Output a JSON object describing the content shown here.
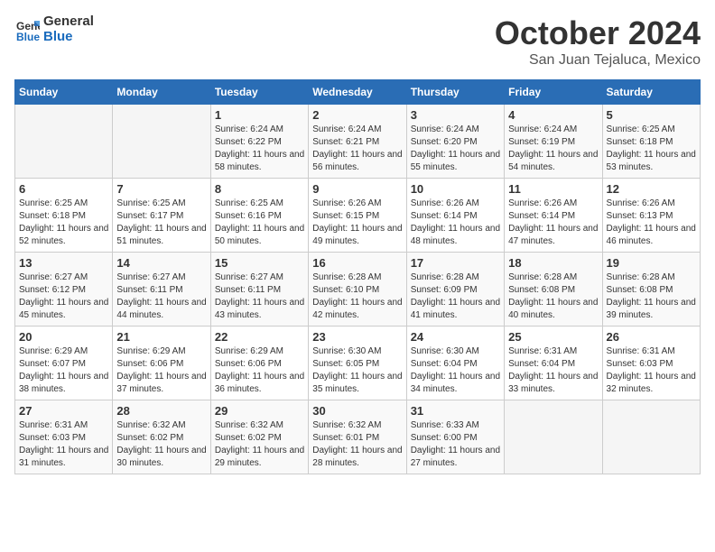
{
  "header": {
    "logo_line1": "General",
    "logo_line2": "Blue",
    "month_year": "October 2024",
    "location": "San Juan Tejaluca, Mexico"
  },
  "weekdays": [
    "Sunday",
    "Monday",
    "Tuesday",
    "Wednesday",
    "Thursday",
    "Friday",
    "Saturday"
  ],
  "weeks": [
    [
      {
        "day": "",
        "sunrise": "",
        "sunset": "",
        "daylight": ""
      },
      {
        "day": "",
        "sunrise": "",
        "sunset": "",
        "daylight": ""
      },
      {
        "day": "1",
        "sunrise": "Sunrise: 6:24 AM",
        "sunset": "Sunset: 6:22 PM",
        "daylight": "Daylight: 11 hours and 58 minutes."
      },
      {
        "day": "2",
        "sunrise": "Sunrise: 6:24 AM",
        "sunset": "Sunset: 6:21 PM",
        "daylight": "Daylight: 11 hours and 56 minutes."
      },
      {
        "day": "3",
        "sunrise": "Sunrise: 6:24 AM",
        "sunset": "Sunset: 6:20 PM",
        "daylight": "Daylight: 11 hours and 55 minutes."
      },
      {
        "day": "4",
        "sunrise": "Sunrise: 6:24 AM",
        "sunset": "Sunset: 6:19 PM",
        "daylight": "Daylight: 11 hours and 54 minutes."
      },
      {
        "day": "5",
        "sunrise": "Sunrise: 6:25 AM",
        "sunset": "Sunset: 6:18 PM",
        "daylight": "Daylight: 11 hours and 53 minutes."
      }
    ],
    [
      {
        "day": "6",
        "sunrise": "Sunrise: 6:25 AM",
        "sunset": "Sunset: 6:18 PM",
        "daylight": "Daylight: 11 hours and 52 minutes."
      },
      {
        "day": "7",
        "sunrise": "Sunrise: 6:25 AM",
        "sunset": "Sunset: 6:17 PM",
        "daylight": "Daylight: 11 hours and 51 minutes."
      },
      {
        "day": "8",
        "sunrise": "Sunrise: 6:25 AM",
        "sunset": "Sunset: 6:16 PM",
        "daylight": "Daylight: 11 hours and 50 minutes."
      },
      {
        "day": "9",
        "sunrise": "Sunrise: 6:26 AM",
        "sunset": "Sunset: 6:15 PM",
        "daylight": "Daylight: 11 hours and 49 minutes."
      },
      {
        "day": "10",
        "sunrise": "Sunrise: 6:26 AM",
        "sunset": "Sunset: 6:14 PM",
        "daylight": "Daylight: 11 hours and 48 minutes."
      },
      {
        "day": "11",
        "sunrise": "Sunrise: 6:26 AM",
        "sunset": "Sunset: 6:14 PM",
        "daylight": "Daylight: 11 hours and 47 minutes."
      },
      {
        "day": "12",
        "sunrise": "Sunrise: 6:26 AM",
        "sunset": "Sunset: 6:13 PM",
        "daylight": "Daylight: 11 hours and 46 minutes."
      }
    ],
    [
      {
        "day": "13",
        "sunrise": "Sunrise: 6:27 AM",
        "sunset": "Sunset: 6:12 PM",
        "daylight": "Daylight: 11 hours and 45 minutes."
      },
      {
        "day": "14",
        "sunrise": "Sunrise: 6:27 AM",
        "sunset": "Sunset: 6:11 PM",
        "daylight": "Daylight: 11 hours and 44 minutes."
      },
      {
        "day": "15",
        "sunrise": "Sunrise: 6:27 AM",
        "sunset": "Sunset: 6:11 PM",
        "daylight": "Daylight: 11 hours and 43 minutes."
      },
      {
        "day": "16",
        "sunrise": "Sunrise: 6:28 AM",
        "sunset": "Sunset: 6:10 PM",
        "daylight": "Daylight: 11 hours and 42 minutes."
      },
      {
        "day": "17",
        "sunrise": "Sunrise: 6:28 AM",
        "sunset": "Sunset: 6:09 PM",
        "daylight": "Daylight: 11 hours and 41 minutes."
      },
      {
        "day": "18",
        "sunrise": "Sunrise: 6:28 AM",
        "sunset": "Sunset: 6:08 PM",
        "daylight": "Daylight: 11 hours and 40 minutes."
      },
      {
        "day": "19",
        "sunrise": "Sunrise: 6:28 AM",
        "sunset": "Sunset: 6:08 PM",
        "daylight": "Daylight: 11 hours and 39 minutes."
      }
    ],
    [
      {
        "day": "20",
        "sunrise": "Sunrise: 6:29 AM",
        "sunset": "Sunset: 6:07 PM",
        "daylight": "Daylight: 11 hours and 38 minutes."
      },
      {
        "day": "21",
        "sunrise": "Sunrise: 6:29 AM",
        "sunset": "Sunset: 6:06 PM",
        "daylight": "Daylight: 11 hours and 37 minutes."
      },
      {
        "day": "22",
        "sunrise": "Sunrise: 6:29 AM",
        "sunset": "Sunset: 6:06 PM",
        "daylight": "Daylight: 11 hours and 36 minutes."
      },
      {
        "day": "23",
        "sunrise": "Sunrise: 6:30 AM",
        "sunset": "Sunset: 6:05 PM",
        "daylight": "Daylight: 11 hours and 35 minutes."
      },
      {
        "day": "24",
        "sunrise": "Sunrise: 6:30 AM",
        "sunset": "Sunset: 6:04 PM",
        "daylight": "Daylight: 11 hours and 34 minutes."
      },
      {
        "day": "25",
        "sunrise": "Sunrise: 6:31 AM",
        "sunset": "Sunset: 6:04 PM",
        "daylight": "Daylight: 11 hours and 33 minutes."
      },
      {
        "day": "26",
        "sunrise": "Sunrise: 6:31 AM",
        "sunset": "Sunset: 6:03 PM",
        "daylight": "Daylight: 11 hours and 32 minutes."
      }
    ],
    [
      {
        "day": "27",
        "sunrise": "Sunrise: 6:31 AM",
        "sunset": "Sunset: 6:03 PM",
        "daylight": "Daylight: 11 hours and 31 minutes."
      },
      {
        "day": "28",
        "sunrise": "Sunrise: 6:32 AM",
        "sunset": "Sunset: 6:02 PM",
        "daylight": "Daylight: 11 hours and 30 minutes."
      },
      {
        "day": "29",
        "sunrise": "Sunrise: 6:32 AM",
        "sunset": "Sunset: 6:02 PM",
        "daylight": "Daylight: 11 hours and 29 minutes."
      },
      {
        "day": "30",
        "sunrise": "Sunrise: 6:32 AM",
        "sunset": "Sunset: 6:01 PM",
        "daylight": "Daylight: 11 hours and 28 minutes."
      },
      {
        "day": "31",
        "sunrise": "Sunrise: 6:33 AM",
        "sunset": "Sunset: 6:00 PM",
        "daylight": "Daylight: 11 hours and 27 minutes."
      },
      {
        "day": "",
        "sunrise": "",
        "sunset": "",
        "daylight": ""
      },
      {
        "day": "",
        "sunrise": "",
        "sunset": "",
        "daylight": ""
      }
    ]
  ]
}
